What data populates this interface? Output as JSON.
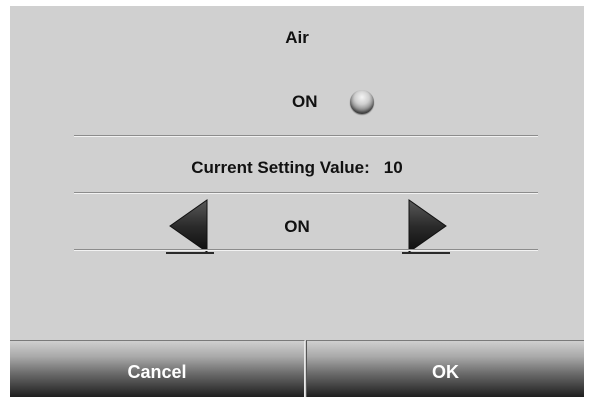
{
  "screen": {
    "title": "Air",
    "status": {
      "label": "ON",
      "indicator_icon": "radio-indicator-icon"
    },
    "current_setting": {
      "label": "Current Setting Value:",
      "value": "10"
    },
    "selector": {
      "value": "ON",
      "prev_icon": "triangle-left-icon",
      "next_icon": "triangle-right-icon"
    },
    "footer": {
      "cancel_label": "Cancel",
      "ok_label": "OK"
    }
  },
  "colors": {
    "background": "#d0d0d0",
    "text": "#111111",
    "button_text": "#ffffff",
    "button_dark": "#1e1e1e"
  }
}
